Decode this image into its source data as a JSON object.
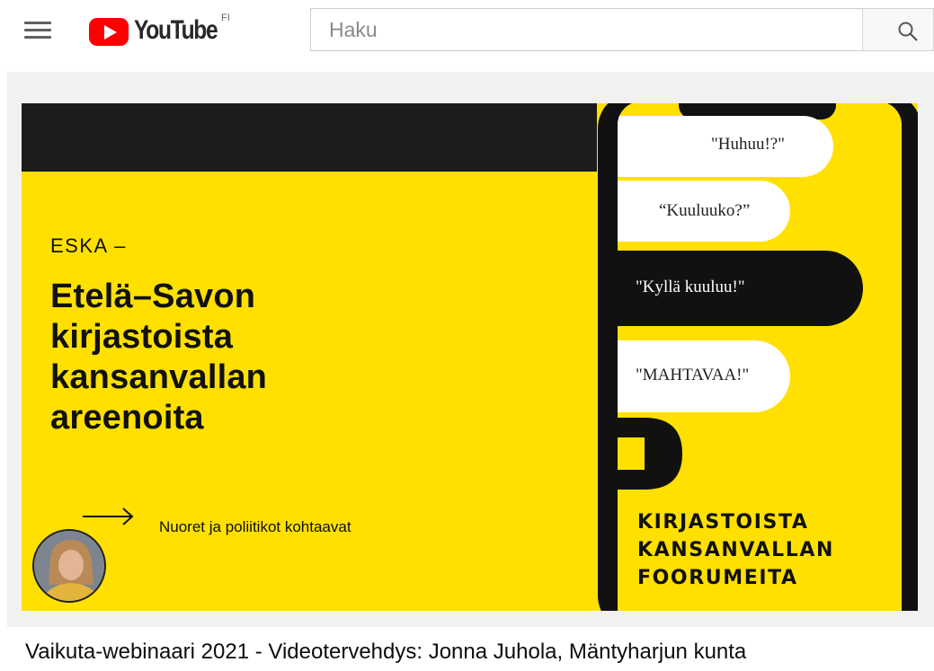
{
  "header": {
    "logo_text": "YouTube",
    "country_code": "FI",
    "search_placeholder": "Haku"
  },
  "video": {
    "title": "Vaikuta-webinaari 2021 - Videotervehdys: Jonna Juhola, Mäntyharjun kunta",
    "thumbnail": {
      "kicker": "ESKA –",
      "headline": [
        "Etelä–Savon",
        "kirjastoista",
        "kansanvallan",
        "areenoita"
      ],
      "subtitle": "Nuoret ja poliitikot kohtaavat",
      "bubbles": [
        "\"Huhuu!?\"",
        "“Kuuluuko?”",
        "\"Kyllä kuuluu!\"",
        "\"MAHTAVAA!\""
      ],
      "phone_text": [
        "KIRJASTOISTA",
        "KANSANVALLAN",
        "FOORUMEITA"
      ],
      "colors": {
        "accent_yellow": "#ffe000",
        "dark": "#111111"
      }
    }
  },
  "colors": {
    "brand_red": "#ff0000"
  }
}
